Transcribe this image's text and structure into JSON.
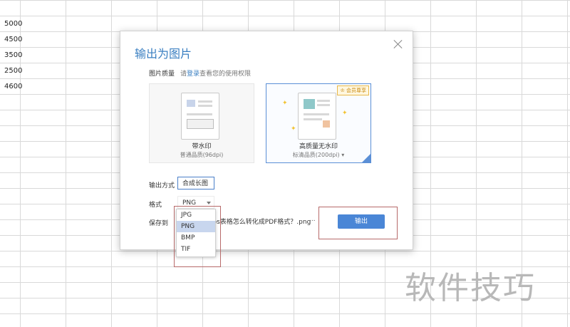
{
  "sheet": {
    "col_a_values": [
      "5000",
      "4500",
      "3500",
      "2500",
      "4600"
    ]
  },
  "dialog": {
    "title": "输出为图片",
    "quality_label": "图片质量",
    "hint_prefix": "请",
    "hint_link": "登录",
    "hint_suffix": "查看您的使用权限",
    "options": [
      {
        "title": "带水印",
        "subtitle": "普通品质(96dpi)"
      },
      {
        "title": "高质量无水印",
        "subtitle": "标清品质(200dpi)",
        "badge": "会员尊享"
      }
    ],
    "output_mode_label": "输出方式",
    "output_mode_value": "合成长图",
    "format_label": "格式",
    "format_value": "PNG",
    "format_options": [
      "JPG",
      "PNG",
      "BMP",
      "TIF"
    ],
    "save_label": "保存到",
    "save_path": "wps表格怎么转化成PDF格式？.png",
    "browse_label": "...",
    "output_button": "输出"
  },
  "watermark": "软件技巧",
  "colors": {
    "accent": "#4a86d6",
    "title": "#3a7fc1",
    "dropdown_selected": "#c8d6ee",
    "highlight_box": "#b76a6a"
  }
}
